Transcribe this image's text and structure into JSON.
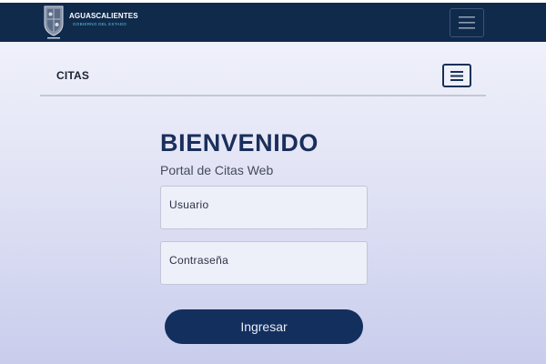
{
  "header": {
    "brand_name": "AGUASCALIENTES",
    "brand_sub": "GOBIERNO DEL ESTADO",
    "menu_icon": "hamburger-icon"
  },
  "subnav": {
    "title": "CITAS",
    "menu_icon": "hamburger-icon"
  },
  "login": {
    "heading": "BIENVENIDO",
    "subheading": "Portal de Citas Web",
    "username_label": "Usuario",
    "username_value": "",
    "password_label": "Contraseña",
    "password_value": "",
    "submit_label": "Ingresar"
  },
  "colors": {
    "header_bg": "#102a4c",
    "accent": "#132f5e",
    "heading": "#1a2f5a",
    "brand_sub": "#5cc6d6"
  }
}
